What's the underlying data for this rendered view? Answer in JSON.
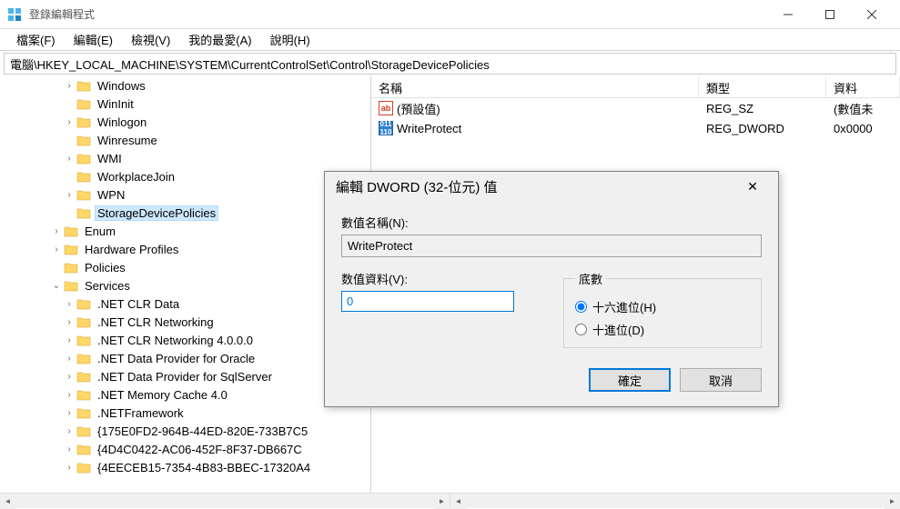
{
  "window": {
    "title": "登錄編輯程式"
  },
  "menu": {
    "file": "檔案(F)",
    "edit": "編輯(E)",
    "view": "檢視(V)",
    "favorites": "我的最愛(A)",
    "help": "說明(H)"
  },
  "address": "電腦\\HKEY_LOCAL_MACHINE\\SYSTEM\\CurrentControlSet\\Control\\StorageDevicePolicies",
  "tree": [
    {
      "indent": 5,
      "toggle": ">",
      "label": "Windows"
    },
    {
      "indent": 5,
      "toggle": "",
      "label": "WinInit"
    },
    {
      "indent": 5,
      "toggle": ">",
      "label": "Winlogon"
    },
    {
      "indent": 5,
      "toggle": "",
      "label": "Winresume"
    },
    {
      "indent": 5,
      "toggle": ">",
      "label": "WMI"
    },
    {
      "indent": 5,
      "toggle": "",
      "label": "WorkplaceJoin"
    },
    {
      "indent": 5,
      "toggle": ">",
      "label": "WPN"
    },
    {
      "indent": 5,
      "toggle": "",
      "label": "StorageDevicePolicies",
      "selected": true
    },
    {
      "indent": 4,
      "toggle": ">",
      "label": "Enum"
    },
    {
      "indent": 4,
      "toggle": ">",
      "label": "Hardware Profiles"
    },
    {
      "indent": 4,
      "toggle": "",
      "label": "Policies"
    },
    {
      "indent": 4,
      "toggle": "v",
      "label": "Services"
    },
    {
      "indent": 5,
      "toggle": ">",
      "label": ".NET CLR Data"
    },
    {
      "indent": 5,
      "toggle": ">",
      "label": ".NET CLR Networking"
    },
    {
      "indent": 5,
      "toggle": ">",
      "label": ".NET CLR Networking 4.0.0.0"
    },
    {
      "indent": 5,
      "toggle": ">",
      "label": ".NET Data Provider for Oracle"
    },
    {
      "indent": 5,
      "toggle": ">",
      "label": ".NET Data Provider for SqlServer"
    },
    {
      "indent": 5,
      "toggle": ">",
      "label": ".NET Memory Cache 4.0"
    },
    {
      "indent": 5,
      "toggle": ">",
      "label": ".NETFramework"
    },
    {
      "indent": 5,
      "toggle": ">",
      "label": "{175E0FD2-964B-44ED-820E-733B7C5"
    },
    {
      "indent": 5,
      "toggle": ">",
      "label": "{4D4C0422-AC06-452F-8F37-DB667C"
    },
    {
      "indent": 5,
      "toggle": ">",
      "label": "{4EECEB15-7354-4B83-BBEC-17320A4"
    }
  ],
  "list": {
    "headers": {
      "name": "名稱",
      "type": "類型",
      "data": "資料"
    },
    "rows": [
      {
        "icon": "ab",
        "name": "(預設值)",
        "type": "REG_SZ",
        "data": "(數值未"
      },
      {
        "icon": "dw",
        "name": "WriteProtect",
        "type": "REG_DWORD",
        "data": "0x0000"
      }
    ]
  },
  "dialog": {
    "title": "編輯 DWORD (32-位元) 值",
    "name_label": "數值名稱(N):",
    "name_value": "WriteProtect",
    "data_label": "数值資料(V):",
    "data_value": "0",
    "base_label": "底數",
    "hex_label": "十六進位(H)",
    "dec_label": "十進位(D)",
    "ok": "確定",
    "cancel": "取消"
  }
}
